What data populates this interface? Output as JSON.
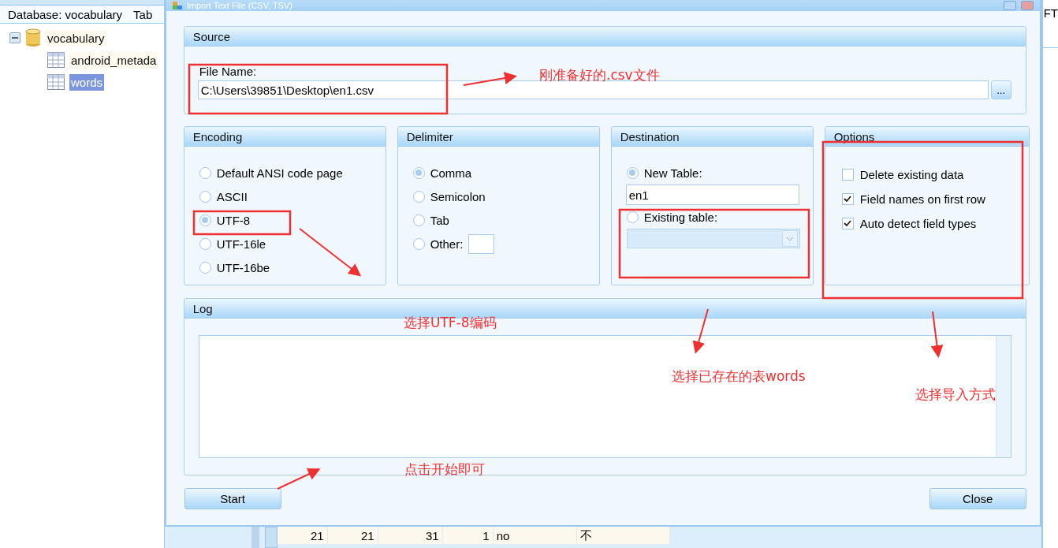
{
  "background_app": {
    "header": "Database: vocabulary",
    "header_2": "Tab",
    "tree": [
      {
        "label": "vocabulary",
        "expanded": true,
        "children": [
          {
            "label": "android_metada",
            "selected": false
          },
          {
            "label": "words",
            "selected": true
          }
        ]
      }
    ],
    "right_column_header": "FT",
    "table_row": [
      "21",
      "21",
      "31",
      "1",
      "no",
      "不"
    ]
  },
  "dialog": {
    "title": "Import Text File (CSV, TSV)",
    "source": {
      "title": "Source",
      "file_label": "File Name:",
      "file_value": "C:\\Users\\39851\\Desktop\\en1.csv",
      "browse_button": "..."
    },
    "encoding": {
      "title": "Encoding",
      "options": [
        {
          "label": "Default ANSI code page",
          "selected": false
        },
        {
          "label": "ASCII",
          "selected": false
        },
        {
          "label": "UTF-8",
          "selected": true
        },
        {
          "label": "UTF-16le",
          "selected": false
        },
        {
          "label": "UTF-16be",
          "selected": false
        }
      ]
    },
    "delimiter": {
      "title": "Delimiter",
      "options": [
        {
          "label": "Comma",
          "selected": true,
          "kind": "plain"
        },
        {
          "label": "Semicolon",
          "selected": false,
          "kind": "plain"
        },
        {
          "label": "Tab",
          "selected": false,
          "kind": "plain"
        },
        {
          "label": "Other:",
          "selected": false,
          "kind": "input"
        }
      ]
    },
    "destination": {
      "title": "Destination",
      "new_table": {
        "label": "New Table:",
        "selected": true,
        "value": "en1"
      },
      "existing_table": {
        "label": "Existing table:",
        "selected": false
      }
    },
    "options": {
      "title": "Options",
      "items": [
        {
          "label": "Delete existing data",
          "checked": false
        },
        {
          "label": "Field names on first row",
          "checked": true
        },
        {
          "label": "Auto detect field types",
          "checked": true
        }
      ]
    },
    "log": {
      "title": "Log"
    },
    "buttons": [
      {
        "label": "Start"
      },
      {
        "label": "Close"
      }
    ]
  },
  "annotations": [
    {
      "text": "刚准备好的.csv文件"
    },
    {
      "text": "选择UTF-8编码"
    },
    {
      "text": "选择已存在的表words"
    },
    {
      "text": "选择导入方式"
    },
    {
      "text": "点击开始即可"
    }
  ]
}
